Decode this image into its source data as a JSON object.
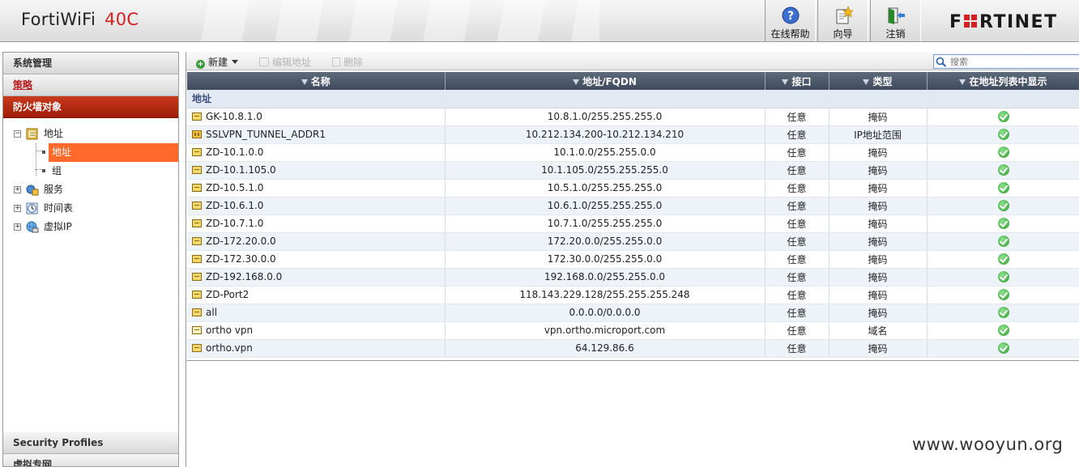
{
  "header": {
    "product": "FortiWiFi",
    "model": "40C",
    "buttons": [
      {
        "label": "在线帮助",
        "icon": "help-icon"
      },
      {
        "label": "向导",
        "icon": "wizard-icon"
      },
      {
        "label": "注销",
        "icon": "logout-icon"
      }
    ],
    "logo": "FORTINET",
    "logo_color": "#d42020"
  },
  "sidebar": {
    "sections_top": [
      "系统管理",
      "策略",
      "防火墙对象"
    ],
    "tree": [
      {
        "label": "地址",
        "expanded": true,
        "icon": "address-icon",
        "children": [
          {
            "label": "地址",
            "selected": true
          },
          {
            "label": "组"
          }
        ]
      },
      {
        "label": "服务",
        "icon": "service-icon"
      },
      {
        "label": "时间表",
        "icon": "schedule-icon"
      },
      {
        "label": "虚拟IP",
        "icon": "virtual-ip-icon"
      }
    ],
    "sections_bottom": [
      "Security Profiles",
      "虚拟专网"
    ],
    "active_color": "#a01c0a",
    "selected_color": "#ff6a2a"
  },
  "toolbar": {
    "new_label": "新建",
    "edit_label": "编辑地址",
    "delete_label": "删除",
    "search_placeholder": "搜索"
  },
  "table": {
    "columns": [
      "名称",
      "地址/FQDN",
      "接口",
      "类型",
      "在地址列表中显示"
    ],
    "group_label": "地址",
    "rows": [
      {
        "name": "GK-10.8.1.0",
        "address": "10.8.1.0/255.255.255.0",
        "interface": "任意",
        "type": "掩码",
        "icon": "subnet"
      },
      {
        "name": "SSLVPN_TUNNEL_ADDR1",
        "address": "10.212.134.200-10.212.134.210",
        "interface": "任意",
        "type": "IP地址范围",
        "icon": "range"
      },
      {
        "name": "ZD-10.1.0.0",
        "address": "10.1.0.0/255.255.0.0",
        "interface": "任意",
        "type": "掩码",
        "icon": "subnet"
      },
      {
        "name": "ZD-10.1.105.0",
        "address": "10.1.105.0/255.255.255.0",
        "interface": "任意",
        "type": "掩码",
        "icon": "subnet"
      },
      {
        "name": "ZD-10.5.1.0",
        "address": "10.5.1.0/255.255.255.0",
        "interface": "任意",
        "type": "掩码",
        "icon": "subnet"
      },
      {
        "name": "ZD-10.6.1.0",
        "address": "10.6.1.0/255.255.255.0",
        "interface": "任意",
        "type": "掩码",
        "icon": "subnet"
      },
      {
        "name": "ZD-10.7.1.0",
        "address": "10.7.1.0/255.255.255.0",
        "interface": "任意",
        "type": "掩码",
        "icon": "subnet"
      },
      {
        "name": "ZD-172.20.0.0",
        "address": "172.20.0.0/255.255.0.0",
        "interface": "任意",
        "type": "掩码",
        "icon": "subnet"
      },
      {
        "name": "ZD-172.30.0.0",
        "address": "172.30.0.0/255.255.0.0",
        "interface": "任意",
        "type": "掩码",
        "icon": "subnet"
      },
      {
        "name": "ZD-192.168.0.0",
        "address": "192.168.0.0/255.255.0.0",
        "interface": "任意",
        "type": "掩码",
        "icon": "subnet"
      },
      {
        "name": "ZD-Port2",
        "address": "118.143.229.128/255.255.255.248",
        "interface": "任意",
        "type": "掩码",
        "icon": "subnet"
      },
      {
        "name": "all",
        "address": "0.0.0.0/0.0.0.0",
        "interface": "任意",
        "type": "掩码",
        "icon": "subnet"
      },
      {
        "name": "ortho vpn",
        "address": "vpn.ortho.microport.com",
        "interface": "任意",
        "type": "域名",
        "icon": "fqdn"
      },
      {
        "name": "ortho.vpn",
        "address": "64.129.86.6",
        "interface": "任意",
        "type": "掩码",
        "icon": "subnet"
      }
    ]
  },
  "watermark": "www.wooyun.org"
}
